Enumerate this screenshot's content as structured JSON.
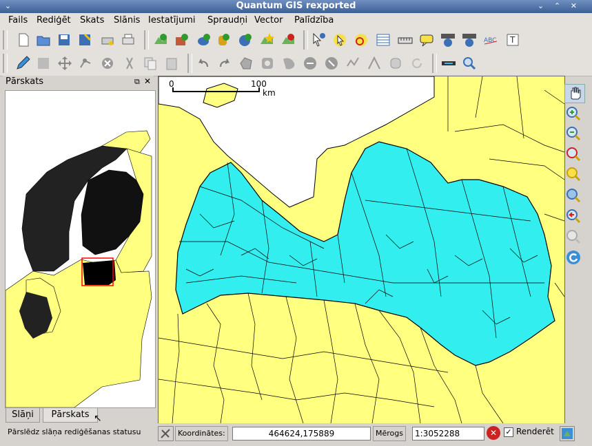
{
  "window": {
    "title": "Quantum GIS rexported"
  },
  "menu": [
    "Fails",
    "Rediģēt",
    "Skats",
    "Slānis",
    "Iestatījumi",
    "Spraudņi",
    "Vector",
    "Palīdzība"
  ],
  "panel": {
    "title": "Pārskats",
    "tabs": [
      "Slāņi",
      "Pārskats"
    ]
  },
  "scalebar": {
    "start": "0",
    "end": "100",
    "unit": "km"
  },
  "status": {
    "message": "Pārslēdz slāņa rediģēšanas statusu",
    "coords_label": "Koordinātes:",
    "coords_value": "464624,175889",
    "scale_label": "Mērogs",
    "scale_value": "1:3052288",
    "render_label": "Renderēt",
    "render_checked": true
  },
  "colors": {
    "land": "#ffff80",
    "selected": "#33eeee",
    "water": "#ffffff",
    "extent": "#ff0000"
  }
}
